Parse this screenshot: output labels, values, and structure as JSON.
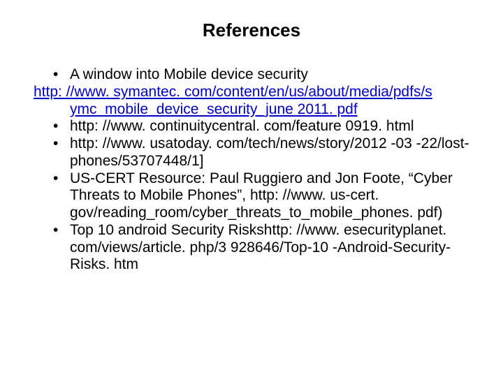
{
  "title": "References",
  "items": {
    "i1_lead": "A window into Mobile device security",
    "i1_link_line1": "http: //www. symantec. com/content/en/us/about/media/pdfs/s",
    "i1_link_line2": "ymc_mobile_device_security_june 2011. pdf",
    "i2": " http: //www. continuitycentral. com/feature 0919. html",
    "i3": " http: //www. usatoday. com/tech/news/story/2012 -03 -22/lost-phones/53707448/1]",
    "i4": " US-CERT Resource: Paul Ruggiero and Jon Foote, “Cyber Threats to Mobile Phones”, http: //www. us-cert. gov/reading_room/cyber_threats_to_mobile_phones. pdf)",
    "i5": "Top 10 android Security Riskshttp: //www. esecurityplanet. com/views/article. php/3 928646/Top-10 -Android-Security-Risks. htm"
  }
}
